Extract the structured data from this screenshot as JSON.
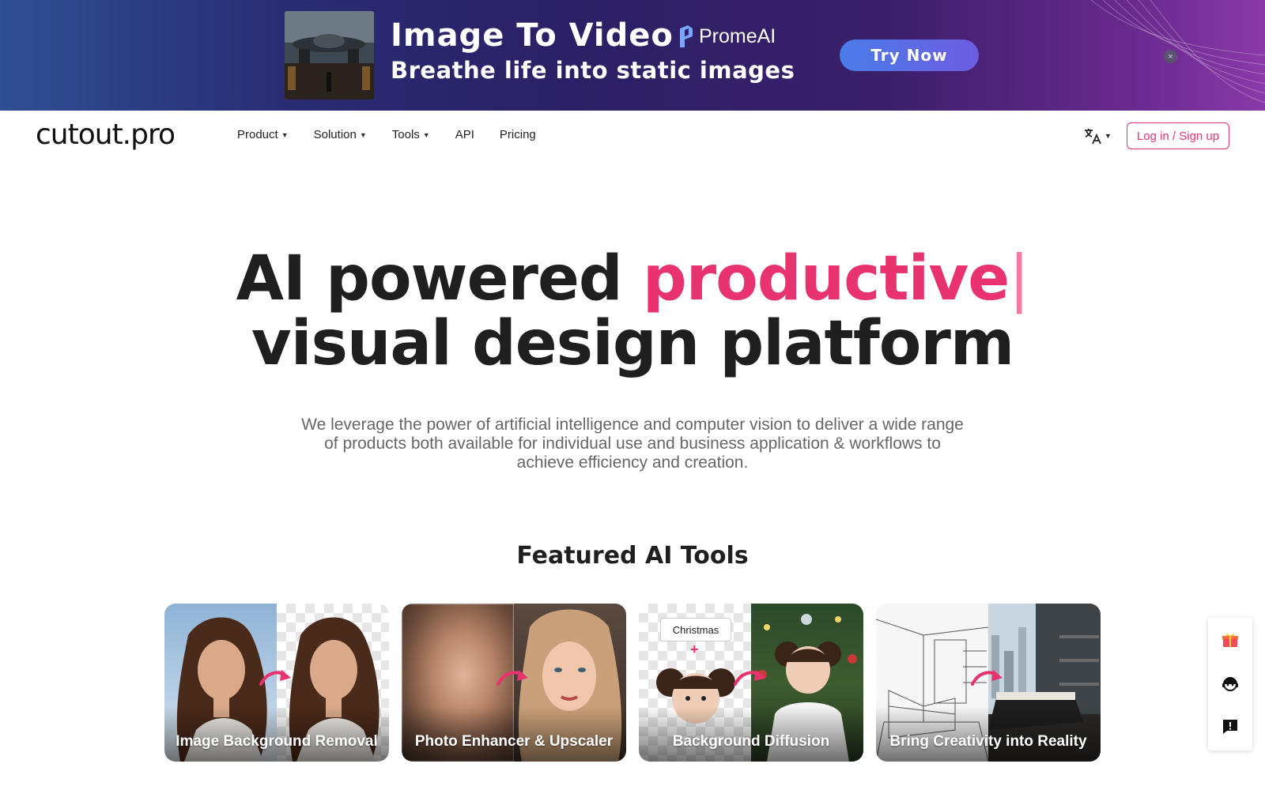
{
  "banner": {
    "title": "Image To Video",
    "subtitle": "Breathe life into static images",
    "brand": "PromeAI",
    "cta_label": "Try Now",
    "close_symbol": "×",
    "colors": {
      "cta_start": "#4a7ce8",
      "cta_end": "#6d5ce0"
    }
  },
  "nav": {
    "logo": "cutout.pro",
    "items": [
      {
        "label": "Product",
        "has_menu": true
      },
      {
        "label": "Solution",
        "has_menu": true
      },
      {
        "label": "Tools",
        "has_menu": true
      },
      {
        "label": "API",
        "has_menu": false
      },
      {
        "label": "Pricing",
        "has_menu": false
      }
    ],
    "chevron": "⌄",
    "language_icon": "translate-icon",
    "login_label": "Log in / Sign up"
  },
  "hero": {
    "title_part1": "AI powered ",
    "title_accent": "productive",
    "title_cursor": "|",
    "title_part2": "visual design platform",
    "description": "We leverage the power of artificial intelligence and computer vision to deliver a wide range of products both available for individual use and business application & workflows to achieve efficiency and creation."
  },
  "featured": {
    "title": "Featured AI Tools",
    "cards": [
      {
        "label": "Image Background Removal"
      },
      {
        "label": "Photo Enhancer & Upscaler"
      },
      {
        "label": "Background Diffusion",
        "tag": "Christmas",
        "plus": "+"
      },
      {
        "label": "Bring Creativity into Reality"
      }
    ]
  },
  "side_widget": {
    "icons": [
      "gift-icon",
      "support-agent-icon",
      "feedback-icon"
    ]
  },
  "colors": {
    "accent": "#e8336e",
    "text_dark": "#1f1f1f",
    "text_muted": "#666666"
  }
}
